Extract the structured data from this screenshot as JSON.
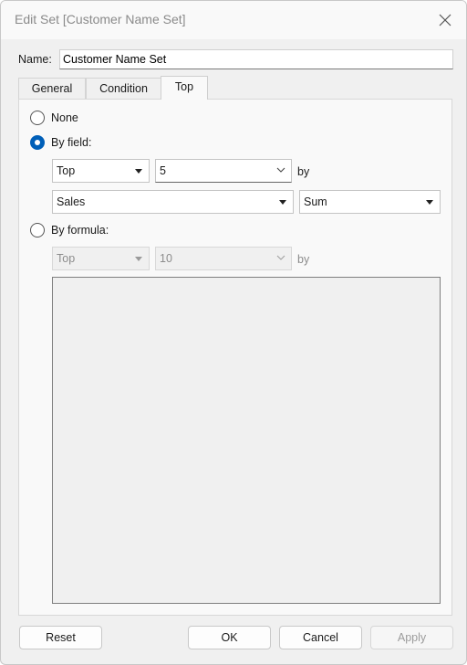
{
  "dialog": {
    "title": "Edit Set [Customer Name Set]",
    "close_icon": "close-icon"
  },
  "name": {
    "label": "Name:",
    "value": "Customer Name Set"
  },
  "tabs": [
    {
      "label": "General",
      "active": false
    },
    {
      "label": "Condition",
      "active": false
    },
    {
      "label": "Top",
      "active": true
    }
  ],
  "top_tab": {
    "none_label": "None",
    "by_field_label": "By field:",
    "by_formula_label": "By formula:",
    "selected_option": "By field:",
    "by_field": {
      "direction": "Top",
      "count": "5",
      "by_label": "by",
      "field": "Sales",
      "aggregation": "Sum"
    },
    "by_formula": {
      "direction": "Top",
      "count": "10",
      "by_label": "by",
      "formula_text": ""
    }
  },
  "buttons": {
    "reset": "Reset",
    "ok": "OK",
    "cancel": "Cancel",
    "apply": "Apply"
  },
  "colors": {
    "accent": "#005fb8",
    "disabled_text": "#8c8c8c"
  }
}
